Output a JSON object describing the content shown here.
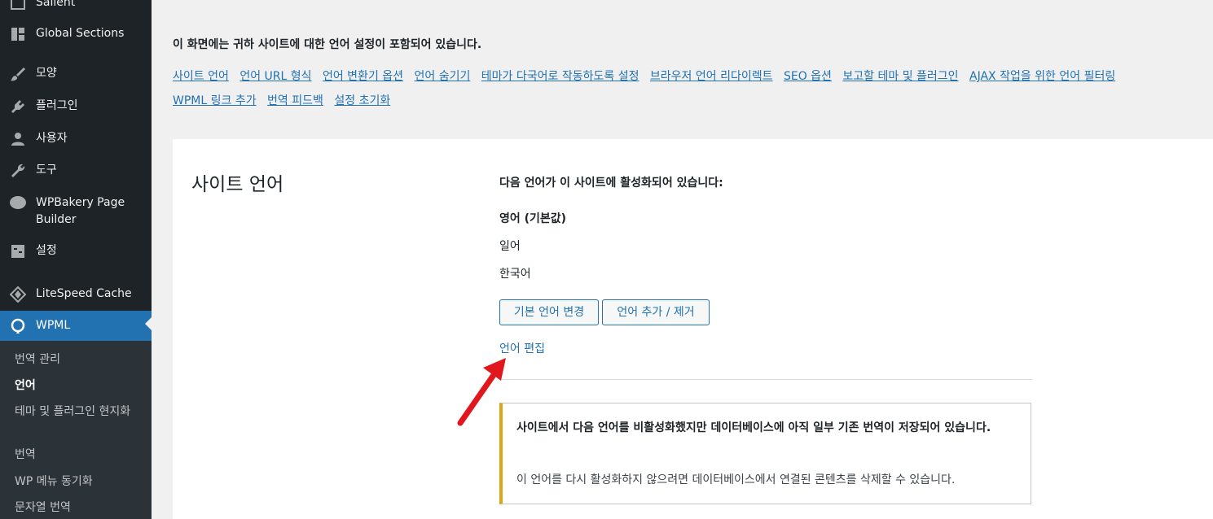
{
  "sidebar": {
    "items": [
      {
        "label": "Salient",
        "icon": "salient-icon"
      },
      {
        "label": "Global Sections",
        "icon": "grid-icon"
      },
      {
        "label": "모양",
        "icon": "brush-icon"
      },
      {
        "label": "플러그인",
        "icon": "plugin-icon"
      },
      {
        "label": "사용자",
        "icon": "user-icon"
      },
      {
        "label": "도구",
        "icon": "wrench-icon"
      },
      {
        "label": "WPBakery Page Builder",
        "icon": "wpbakery-icon"
      },
      {
        "label": "설정",
        "icon": "settings-icon"
      },
      {
        "label": "LiteSpeed Cache",
        "icon": "litespeed-icon"
      },
      {
        "label": "WPML",
        "icon": "wpml-icon"
      }
    ],
    "submenu": [
      "번역 관리",
      "언어",
      "테마 및 플러그인 현지화",
      "번역",
      "WP 메뉴 동기화",
      "문자열 번역"
    ],
    "active_submenu": "언어"
  },
  "intro": {
    "text": "이 화면에는 귀하 사이트에 대한 언어 설정이 포함되어 있습니다.",
    "links": [
      "사이트 언어",
      "언어 URL 형식",
      "언어 변환기 옵션",
      "언어 숨기기",
      "테마가 다국어로 작동하도록 설정",
      "브라우저 언어 리다이렉트",
      "SEO 옵션",
      "보고할 테마 및 플러그인",
      "AJAX 작업을 위한 언어 필터링",
      "WPML 링크 추가",
      "번역 피드백",
      "설정 초기화"
    ]
  },
  "site_languages": {
    "title": "사이트 언어",
    "active_heading": "다음 언어가 이 사이트에 활성화되어 있습니다:",
    "languages": [
      "영어 (기본값)",
      "일어",
      "한국어"
    ],
    "change_default_button": "기본 언어 변경",
    "add_remove_button": "언어 추가 / 제거",
    "edit_link": "언어 편집",
    "notice_title": "사이트에서 다음 언어를 비활성화했지만 데이터베이스에 아직 일부 기존 번역이 저장되어 있습니다.",
    "notice_body": "이 언어를 다시 활성화하지 않으려면 데이터베이스에서 연결된 콘텐츠를 삭제할 수 있습니다."
  },
  "colors": {
    "accent": "#2271b1",
    "sidebar": "#1d2327",
    "warning": "#dba617",
    "arrow": "#e0171c"
  }
}
